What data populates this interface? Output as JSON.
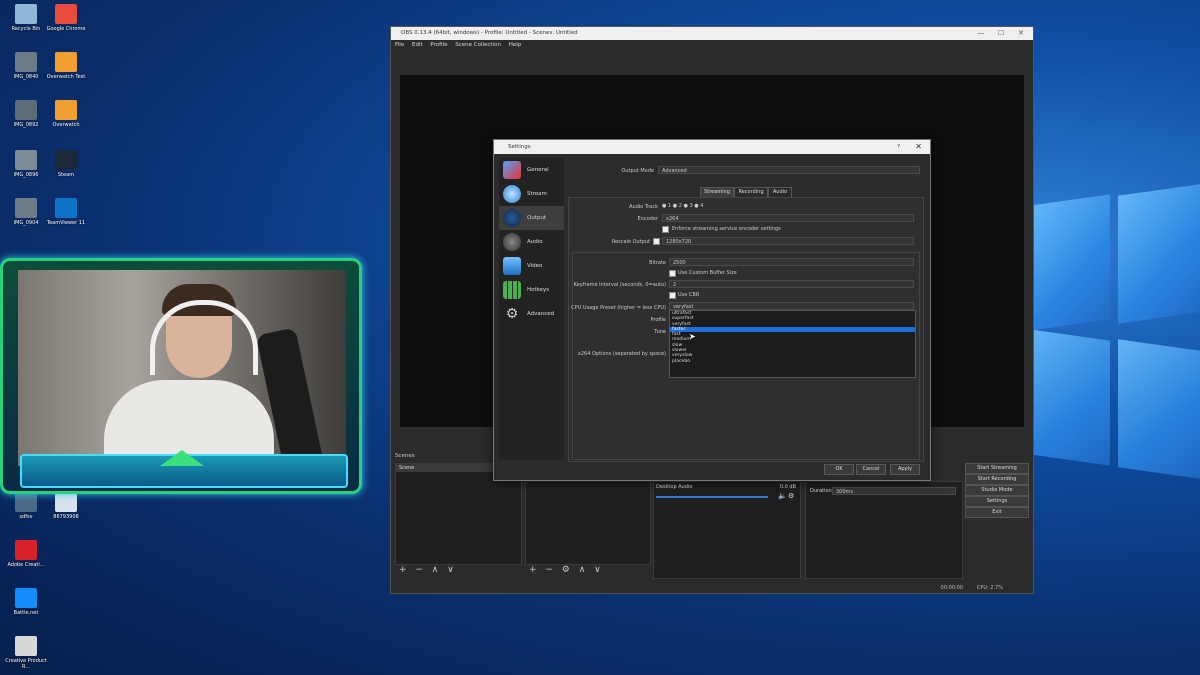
{
  "desktop": {
    "icons": [
      {
        "label": "Recycle Bin",
        "color": "#8fb7d6"
      },
      {
        "label": "Google Chrome",
        "color": "#e74c3c"
      },
      {
        "label": "IMG_0840",
        "color": "#6d7b86"
      },
      {
        "label": "Overwatch Test",
        "color": "#f0a030"
      },
      {
        "label": "IMG_0892",
        "color": "#5d6b76"
      },
      {
        "label": "Overwatch",
        "color": "#f0a030"
      },
      {
        "label": "IMG_0896",
        "color": "#7d8b96"
      },
      {
        "label": "Steam",
        "color": "#1b2838"
      },
      {
        "label": "IMG_0904",
        "color": "#6d7b86"
      },
      {
        "label": "TeamViewer 11",
        "color": "#0e72c8"
      },
      {
        "label": "sdfsv",
        "color": "#4a6a8a"
      },
      {
        "label": "86793908",
        "color": "#d8e2ec"
      },
      {
        "label": "Adobe Creati...",
        "color": "#da1f26"
      },
      {
        "label": "Battle.net",
        "color": "#148eff"
      },
      {
        "label": "Creative Product R...",
        "color": "#d8d8d8"
      }
    ]
  },
  "obs": {
    "title": "OBS 0.13.4 (64bit, windows) - Profile: Untitled - Scenes: Untitled",
    "menu": [
      "File",
      "Edit",
      "Profile",
      "Scene Collection",
      "Help"
    ],
    "scenes_header": "Scenes",
    "scene_item": "Scene",
    "mixer_source": "Desktop Audio",
    "mixer_db": "0.0 dB",
    "duration_label": "Duration",
    "duration_value": "300ms",
    "controls": [
      "Start Streaming",
      "Start Recording",
      "Studio Mode",
      "Settings",
      "Exit"
    ],
    "status_time": "00:00:00",
    "status_cpu": "CPU: 2.7%",
    "toolbar_left": "+ − ∧ ∨",
    "toolbar_mid": "+ − ⚙ ∧ ∨"
  },
  "settings": {
    "title": "Settings",
    "help": "?",
    "close": "✕",
    "sidebar": [
      "General",
      "Stream",
      "Output",
      "Audio",
      "Video",
      "Hotkeys",
      "Advanced"
    ],
    "sidebar_selected": "Output",
    "output_mode_label": "Output Mode",
    "output_mode_value": "Advanced",
    "tabs": [
      "Streaming",
      "Recording",
      "Audio"
    ],
    "audio_track_label": "Audio Track",
    "audio_tracks": [
      "1",
      "2",
      "3",
      "4"
    ],
    "encoder_label": "Encoder",
    "encoder_value": "x264",
    "enforce_label": "Enforce streaming service encoder settings",
    "rescale_label": "Rescale Output",
    "rescale_value": "1280x720",
    "bitrate_label": "Bitrate",
    "bitrate_value": "2500",
    "custom_buffer_label": "Use Custom Buffer Size",
    "keyframe_label": "Keyframe Interval (seconds, 0=auto)",
    "keyframe_value": "2",
    "cbr_label": "Use CBR",
    "preset_label": "CPU Usage Preset (higher = less CPU)",
    "preset_value": "veryfast",
    "profile_label": "Profile",
    "tune_label": "Tune",
    "x264_options_label": "x264 Options (separated by space)",
    "preset_options": [
      "ultrafast",
      "superfast",
      "veryfast",
      "faster",
      "fast",
      "medium",
      "slow",
      "slower",
      "veryslow",
      "placebo"
    ],
    "preset_highlight": "faster",
    "buttons": {
      "ok": "OK",
      "cancel": "Cancel",
      "apply": "Apply"
    }
  }
}
